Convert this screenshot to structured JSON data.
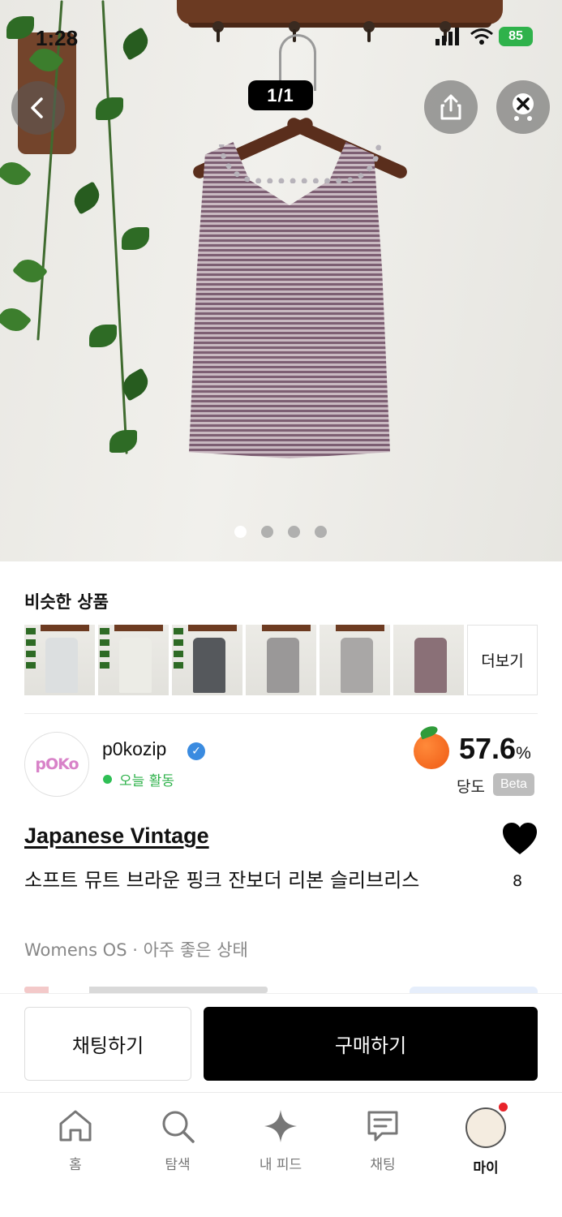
{
  "status_bar": {
    "time": "1:28",
    "battery": "85"
  },
  "hero": {
    "counter": "1/1",
    "dots": 4,
    "active_dot": 0
  },
  "similar": {
    "title": "비슷한 상품",
    "more_label": "더보기",
    "thumbs": [
      {
        "color": "#dcdfe0"
      },
      {
        "color": "#ecece6"
      },
      {
        "color": "#55585c"
      },
      {
        "color": "#9a9898"
      },
      {
        "color": "#a9a7a6"
      },
      {
        "color": "#8a7077"
      }
    ]
  },
  "seller": {
    "name": "p0kozip",
    "activity": "오늘 활동",
    "score_value": "57.6",
    "score_unit": "%",
    "score_label": "당도",
    "beta": "Beta",
    "avatar_text": "pOKo"
  },
  "product": {
    "brand": "Japanese Vintage",
    "title": "소프트 뮤트 브라운 핑크 잔보더 리본 슬리브리스",
    "meta": "Womens OS · 아주 좋은 상태",
    "likes": "8"
  },
  "actions": {
    "chat": "채팅하기",
    "buy": "구매하기"
  },
  "tabs": [
    {
      "id": "home",
      "label": "홈"
    },
    {
      "id": "search",
      "label": "탐색"
    },
    {
      "id": "feed",
      "label": "내 피드"
    },
    {
      "id": "chat",
      "label": "채팅"
    },
    {
      "id": "my",
      "label": "마이"
    }
  ],
  "colors": {
    "accent_green": "#2fb24b",
    "verified_blue": "#3a8be0",
    "badge_red": "#e8232a"
  }
}
